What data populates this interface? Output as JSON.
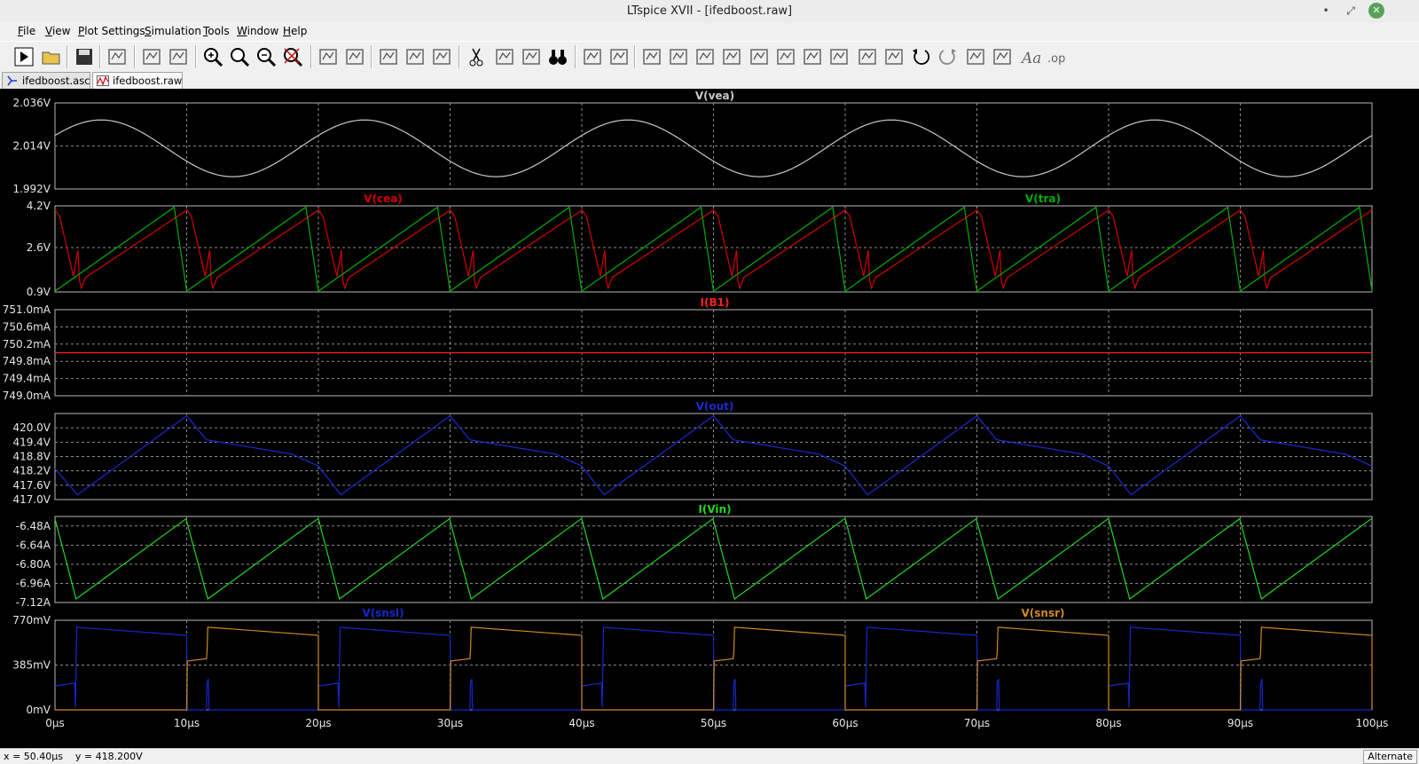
{
  "window": {
    "title": "LTspice XVII - [ifedboost.raw]"
  },
  "menu": [
    {
      "label": "File",
      "mnemonic": "F"
    },
    {
      "label": "View",
      "mnemonic": "V"
    },
    {
      "label": "Plot Settings",
      "mnemonic": "P"
    },
    {
      "label": "Simulation",
      "mnemonic": "S"
    },
    {
      "label": "Tools",
      "mnemonic": "T"
    },
    {
      "label": "Window",
      "mnemonic": "W"
    },
    {
      "label": "Help",
      "mnemonic": "H"
    }
  ],
  "toolbar_icons": [
    "run-icon",
    "open-icon",
    "save-icon",
    "control-panel-icon",
    "run-halt-icon",
    "hand-icon",
    "zoom-in-icon",
    "zoom-area-icon",
    "zoom-out-icon",
    "zoom-cancel-icon",
    "autorange-icon",
    "manual-limits-icon",
    "tile-horizontal-icon",
    "cascade-icon",
    "tile-vertical-icon",
    "cut-icon",
    "copy-icon",
    "paste-icon",
    "find-icon",
    "print-icon",
    "print-preview-icon",
    "wire-icon",
    "ground-icon",
    "label-net-icon",
    "resistor-icon",
    "capacitor-icon",
    "inductor-icon",
    "diode-icon",
    "component-icon",
    "move-icon",
    "drag-icon",
    "undo-icon",
    "redo-icon",
    "rotate-icon",
    "mirror-icon",
    "text-icon",
    "spice-directive-icon"
  ],
  "tabs": [
    {
      "label": "ifedboost.asc",
      "icon": "schematic-icon",
      "active": false
    },
    {
      "label": "ifedboost.raw",
      "icon": "waveform-icon",
      "active": true
    }
  ],
  "status": {
    "coords": "x = 50.40µs    y = 418.200V",
    "mode": "Alternate"
  },
  "chart_data": {
    "type": "line",
    "x_axis": {
      "range": [
        0,
        100
      ],
      "unit": "µs",
      "ticks": [
        "0µs",
        "10µs",
        "20µs",
        "30µs",
        "40µs",
        "50µs",
        "60µs",
        "70µs",
        "80µs",
        "90µs",
        "100µs"
      ]
    },
    "grid": true,
    "panes": [
      {
        "name": "vea",
        "ylim": [
          1.992,
          2.036
        ],
        "ticks": [
          {
            "v": 2.036,
            "label": "2.036V"
          },
          {
            "v": 2.014,
            "label": "2.014V"
          },
          {
            "v": 1.992,
            "label": "1.992V"
          }
        ],
        "series": [
          {
            "name": "V(vea)",
            "color": "#c8c8c8",
            "label_pos": "center",
            "shape": "sine",
            "period": 20,
            "phase": 3.5,
            "mean": 2.0128,
            "amp": 0.0145
          }
        ]
      },
      {
        "name": "cea-tra",
        "ylim": [
          0.9,
          4.2
        ],
        "ticks": [
          {
            "v": 4.2,
            "label": "4.2V"
          },
          {
            "v": 2.6,
            "label": "2.6V"
          },
          {
            "v": 0.9,
            "label": "0.9V"
          }
        ],
        "series": [
          {
            "name": "V(cea)",
            "color": "#d40000",
            "label_pos": "left",
            "shape": "cea",
            "period": 10,
            "points": [
              [
                0,
                4.05
              ],
              [
                0.35,
                3.8
              ],
              [
                1.4,
                1.5
              ],
              [
                1.75,
                2.5
              ],
              [
                1.85,
                1.35
              ],
              [
                2.0,
                1.05
              ],
              [
                2.3,
                1.45
              ],
              [
                9.9,
                4.0
              ]
            ]
          },
          {
            "name": "V(tra)",
            "color": "#00b000",
            "label_pos": "right",
            "shape": "sawtooth",
            "period": 10,
            "points": [
              [
                0,
                0.93
              ],
              [
                9.05,
                4.15
              ],
              [
                10,
                0.93
              ]
            ]
          }
        ]
      },
      {
        "name": "b1",
        "ylim": [
          749.0,
          751.0
        ],
        "ticks": [
          {
            "v": 751.0,
            "label": "751.0mA"
          },
          {
            "v": 750.6,
            "label": "750.6mA"
          },
          {
            "v": 750.2,
            "label": "750.2mA"
          },
          {
            "v": 749.8,
            "label": "749.8mA"
          },
          {
            "v": 749.4,
            "label": "749.4mA"
          },
          {
            "v": 749.0,
            "label": "749.0mA"
          }
        ],
        "series": [
          {
            "name": "I(B1)",
            "color": "#ff2020",
            "label_pos": "center",
            "shape": "constant",
            "value": 750.0
          }
        ]
      },
      {
        "name": "out",
        "ylim": [
          417.0,
          420.6
        ],
        "ticks": [
          {
            "v": 420.0,
            "label": "420.0V"
          },
          {
            "v": 419.4,
            "label": "419.4V"
          },
          {
            "v": 418.8,
            "label": "418.8V"
          },
          {
            "v": 418.2,
            "label": "418.2V"
          },
          {
            "v": 417.6,
            "label": "417.6V"
          },
          {
            "v": 417.0,
            "label": "417.0V"
          }
        ],
        "series": [
          {
            "name": "V(out)",
            "color": "#1a2ad0",
            "label_pos": "center",
            "shape": "polyline",
            "points": [
              [
                0,
                418.3
              ],
              [
                1.7,
                417.2
              ],
              [
                10,
                420.5
              ],
              [
                11.5,
                419.5
              ],
              [
                18,
                418.9
              ],
              [
                20,
                418.4
              ],
              [
                21.7,
                417.2
              ],
              [
                30,
                420.5
              ],
              [
                31.5,
                419.5
              ],
              [
                38,
                418.9
              ],
              [
                40,
                418.4
              ],
              [
                41.7,
                417.2
              ],
              [
                50,
                420.5
              ],
              [
                51.5,
                419.5
              ],
              [
                58,
                418.9
              ],
              [
                60,
                418.4
              ],
              [
                61.7,
                417.2
              ],
              [
                70,
                420.5
              ],
              [
                71.5,
                419.5
              ],
              [
                78,
                418.9
              ],
              [
                80,
                418.4
              ],
              [
                81.7,
                417.2
              ],
              [
                90,
                420.5
              ],
              [
                91.5,
                419.5
              ],
              [
                98,
                418.9
              ],
              [
                100,
                418.4
              ]
            ]
          }
        ]
      },
      {
        "name": "vin",
        "ylim": [
          -7.12,
          -6.4
        ],
        "ticks": [
          {
            "v": -6.48,
            "label": "-6.48A"
          },
          {
            "v": -6.64,
            "label": "-6.64A"
          },
          {
            "v": -6.8,
            "label": "-6.80A"
          },
          {
            "v": -6.96,
            "label": "-6.96A"
          },
          {
            "v": -7.12,
            "label": "-7.12A"
          }
        ],
        "series": [
          {
            "name": "I(Vin)",
            "color": "#20d820",
            "label_pos": "center",
            "shape": "sawtooth",
            "period": 20,
            "points": [
              [
                0,
                -6.42
              ],
              [
                1.6,
                -7.09
              ],
              [
                9.95,
                -6.42
              ],
              [
                11.6,
                -7.09
              ],
              [
                19.95,
                -6.42
              ]
            ]
          }
        ]
      },
      {
        "name": "sns",
        "ylim": [
          0,
          770
        ],
        "ticks": [
          {
            "v": 770,
            "label": "770mV"
          },
          {
            "v": 385,
            "label": "385mV"
          },
          {
            "v": 0,
            "label": "0mV"
          }
        ],
        "series": [
          {
            "name": "V(snsl)",
            "color": "#1428cc",
            "label_pos": "left",
            "shape": "snsl",
            "period": 20,
            "points": [
              [
                0,
                205
              ],
              [
                1.5,
                230
              ],
              [
                1.55,
                20
              ],
              [
                1.65,
                710
              ],
              [
                10,
                640
              ],
              [
                10.05,
                0
              ],
              [
                11.5,
                0
              ],
              [
                11.55,
                235
              ],
              [
                11.65,
                265
              ],
              [
                11.7,
                0
              ],
              [
                20,
                0
              ]
            ]
          },
          {
            "name": "V(snsr)",
            "color": "#d08a20",
            "label_pos": "right",
            "shape": "snsr",
            "period": 20,
            "points": [
              [
                0,
                0
              ],
              [
                1.55,
                0
              ],
              [
                1.6,
                0
              ],
              [
                10,
                0
              ],
              [
                10.05,
                420
              ],
              [
                11.5,
                440
              ],
              [
                11.55,
                510
              ],
              [
                11.6,
                710
              ],
              [
                20,
                640
              ]
            ]
          }
        ]
      }
    ]
  }
}
